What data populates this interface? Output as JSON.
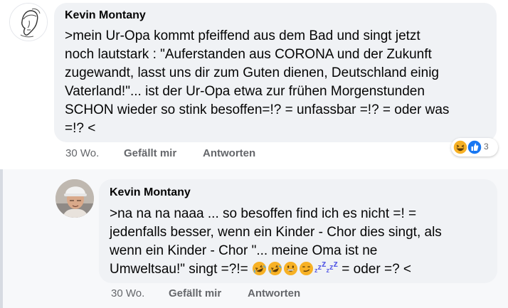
{
  "comment": {
    "author": "Kevin Montany",
    "lines": [
      ">mein Ur-Opa kommt pfeiffend aus dem Bad und singt jetzt",
      "noch lautstark  : \"Auferstanden aus CORONA und der Zukunft",
      "zugewandt, lasst uns dir zum Guten dienen, Deutschland einig",
      "Vaterland!\"... ist der Ur-Opa  etwa zur frühen Morgenstunden",
      "SCHON wieder so stink besoffen=!? = unfassbar =!? = oder was",
      "=!? <"
    ],
    "time": "30 Wo.",
    "like_label": "Gefällt mir",
    "reply_label": "Antworten",
    "reaction_count": "3",
    "reaction_icons": [
      "haha-icon",
      "like-icon"
    ]
  },
  "reply": {
    "author": "Kevin Montany",
    "lines": [
      ">na na na naaa ... so besoffen find ich es nicht =! =",
      "jedenfalls besser, wenn ein Kinder - Chor dies singt, als",
      "wenn ein Kinder - Chor  \"... meine Oma ist ne"
    ],
    "last_line_start": "Umweltsau!\" singt =?!= ",
    "last_line_end": " = oder =? <",
    "inline_emojis": [
      "rofl-icon",
      "rofl-icon",
      "grin-icon",
      "smirk-icon",
      "zzz-icon",
      "zzz-icon"
    ],
    "time": "30 Wo.",
    "like_label": "Gefällt mir",
    "reply_label": "Antworten"
  },
  "colors": {
    "bubble": "#f0f2f5",
    "meta_text": "#65676b",
    "like_blue": "#1877f2",
    "haha_yellow": "#f7b125",
    "zzz_purple": "#5b5fe6",
    "thread_rail": "#d7dbe2"
  }
}
